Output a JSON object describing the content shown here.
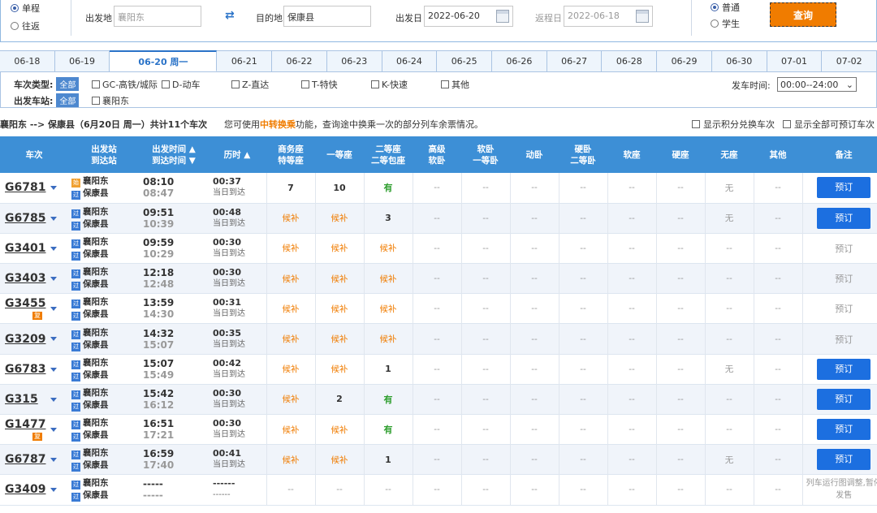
{
  "search": {
    "trip_types": [
      {
        "label": "单程",
        "selected": true
      },
      {
        "label": "往返",
        "selected": false
      }
    ],
    "from_label": "出发地",
    "from_value": "襄阳东",
    "to_label": "目的地",
    "to_value": "保康县",
    "depart_label": "出发日",
    "depart_value": "2022-06-20",
    "return_label": "返程日",
    "return_value": "2022-06-18",
    "ticket_types": [
      {
        "label": "普通",
        "selected": true
      },
      {
        "label": "学生",
        "selected": false
      }
    ],
    "query_label": "查询"
  },
  "date_tabs": [
    "06-18",
    "06-19",
    "06-20 周一",
    "06-21",
    "06-22",
    "06-23",
    "06-24",
    "06-25",
    "06-26",
    "06-27",
    "06-28",
    "06-29",
    "06-30",
    "07-01",
    "07-02"
  ],
  "active_date_index": 2,
  "filters": {
    "type_label": "车次类型:",
    "all_label": "全部",
    "types": [
      "GC-高铁/城际",
      "D-动车",
      "Z-直达",
      "T-特快",
      "K-快速",
      "其他"
    ],
    "station_label": "出发车站:",
    "stations": [
      "襄阳东"
    ],
    "time_label": "发车时间:",
    "time_value": "00:00--24:00"
  },
  "info": {
    "route": "襄阳东 --> 保康县（6月20日 周一）共计11个车次",
    "tip_prefix": "您可使用",
    "tip_link": "中转换乘",
    "tip_suffix": "功能，查询途中换乘一次的部分列车余票情况。",
    "opt_points": "显示积分兑换车次",
    "opt_bookable": "显示全部可预订车次"
  },
  "table": {
    "headers": {
      "train": "车次",
      "station_1": "出发站",
      "station_2": "到达站",
      "time_1": "出发时间 ▲",
      "time_2": "到达时间 ▼",
      "duration": "历时 ▲",
      "business_1": "商务座",
      "business_2": "特等座",
      "first": "一等座",
      "second_1": "二等座",
      "second_2": "二等包座",
      "hsoft_1": "高级",
      "hsoft_2": "软卧",
      "soft_1": "软卧",
      "soft_2": "一等卧",
      "moving": "动卧",
      "hard_1": "硬卧",
      "hard_2": "二等卧",
      "softseat": "软座",
      "hardseat": "硬座",
      "noseat": "无座",
      "other": "其他",
      "note": "备注"
    },
    "rows": [
      {
        "train": "G6781",
        "fu": "",
        "from_tag": "始",
        "from": "襄阳东",
        "to_tag": "过",
        "to": "保康县",
        "dep": "08:10",
        "arr": "08:47",
        "dur": "00:37",
        "arrive": "当日到达",
        "seats": [
          "7",
          "10",
          "有",
          "--",
          "--",
          "--",
          "--",
          "--",
          "--",
          "无",
          "--"
        ],
        "action": "预订",
        "bookable": true
      },
      {
        "train": "G6785",
        "fu": "",
        "from_tag": "过",
        "from": "襄阳东",
        "to_tag": "过",
        "to": "保康县",
        "dep": "09:51",
        "arr": "10:39",
        "dur": "00:48",
        "arrive": "当日到达",
        "seats": [
          "候补",
          "候补",
          "3",
          "--",
          "--",
          "--",
          "--",
          "--",
          "--",
          "无",
          "--"
        ],
        "action": "预订",
        "bookable": true
      },
      {
        "train": "G3401",
        "fu": "",
        "from_tag": "过",
        "from": "襄阳东",
        "to_tag": "过",
        "to": "保康县",
        "dep": "09:59",
        "arr": "10:29",
        "dur": "00:30",
        "arrive": "当日到达",
        "seats": [
          "候补",
          "候补",
          "候补",
          "--",
          "--",
          "--",
          "--",
          "--",
          "--",
          "--",
          "--"
        ],
        "action": "预订",
        "bookable": false
      },
      {
        "train": "G3403",
        "fu": "",
        "from_tag": "过",
        "from": "襄阳东",
        "to_tag": "过",
        "to": "保康县",
        "dep": "12:18",
        "arr": "12:48",
        "dur": "00:30",
        "arrive": "当日到达",
        "seats": [
          "候补",
          "候补",
          "候补",
          "--",
          "--",
          "--",
          "--",
          "--",
          "--",
          "--",
          "--"
        ],
        "action": "预订",
        "bookable": false
      },
      {
        "train": "G3455",
        "fu": "复",
        "from_tag": "过",
        "from": "襄阳东",
        "to_tag": "过",
        "to": "保康县",
        "dep": "13:59",
        "arr": "14:30",
        "dur": "00:31",
        "arrive": "当日到达",
        "seats": [
          "候补",
          "候补",
          "候补",
          "--",
          "--",
          "--",
          "--",
          "--",
          "--",
          "--",
          "--"
        ],
        "action": "预订",
        "bookable": false
      },
      {
        "train": "G3209",
        "fu": "",
        "from_tag": "过",
        "from": "襄阳东",
        "to_tag": "过",
        "to": "保康县",
        "dep": "14:32",
        "arr": "15:07",
        "dur": "00:35",
        "arrive": "当日到达",
        "seats": [
          "候补",
          "候补",
          "候补",
          "--",
          "--",
          "--",
          "--",
          "--",
          "--",
          "--",
          "--"
        ],
        "action": "预订",
        "bookable": false
      },
      {
        "train": "G6783",
        "fu": "",
        "from_tag": "过",
        "from": "襄阳东",
        "to_tag": "过",
        "to": "保康县",
        "dep": "15:07",
        "arr": "15:49",
        "dur": "00:42",
        "arrive": "当日到达",
        "seats": [
          "候补",
          "候补",
          "1",
          "--",
          "--",
          "--",
          "--",
          "--",
          "--",
          "无",
          "--"
        ],
        "action": "预订",
        "bookable": true
      },
      {
        "train": "G315",
        "fu": "",
        "from_tag": "过",
        "from": "襄阳东",
        "to_tag": "过",
        "to": "保康县",
        "dep": "15:42",
        "arr": "16:12",
        "dur": "00:30",
        "arrive": "当日到达",
        "seats": [
          "候补",
          "2",
          "有",
          "--",
          "--",
          "--",
          "--",
          "--",
          "--",
          "--",
          "--"
        ],
        "action": "预订",
        "bookable": true
      },
      {
        "train": "G1477",
        "fu": "复",
        "from_tag": "过",
        "from": "襄阳东",
        "to_tag": "过",
        "to": "保康县",
        "dep": "16:51",
        "arr": "17:21",
        "dur": "00:30",
        "arrive": "当日到达",
        "seats": [
          "候补",
          "候补",
          "有",
          "--",
          "--",
          "--",
          "--",
          "--",
          "--",
          "--",
          "--"
        ],
        "action": "预订",
        "bookable": true
      },
      {
        "train": "G6787",
        "fu": "",
        "from_tag": "过",
        "from": "襄阳东",
        "to_tag": "过",
        "to": "保康县",
        "dep": "16:59",
        "arr": "17:40",
        "dur": "00:41",
        "arrive": "当日到达",
        "seats": [
          "候补",
          "候补",
          "1",
          "--",
          "--",
          "--",
          "--",
          "--",
          "--",
          "无",
          "--"
        ],
        "action": "预订",
        "bookable": true
      },
      {
        "train": "G3409",
        "fu": "",
        "from_tag": "过",
        "from": "襄阳东",
        "to_tag": "过",
        "to": "保康县",
        "dep": "-----",
        "arr": "-----",
        "dur": "------",
        "arrive": "------",
        "seats": [
          "--",
          "--",
          "--",
          "--",
          "--",
          "--",
          "--",
          "--",
          "--",
          "--",
          "--"
        ],
        "action": "列车运行图调整,暂停发售",
        "bookable": false,
        "note": true
      }
    ]
  }
}
